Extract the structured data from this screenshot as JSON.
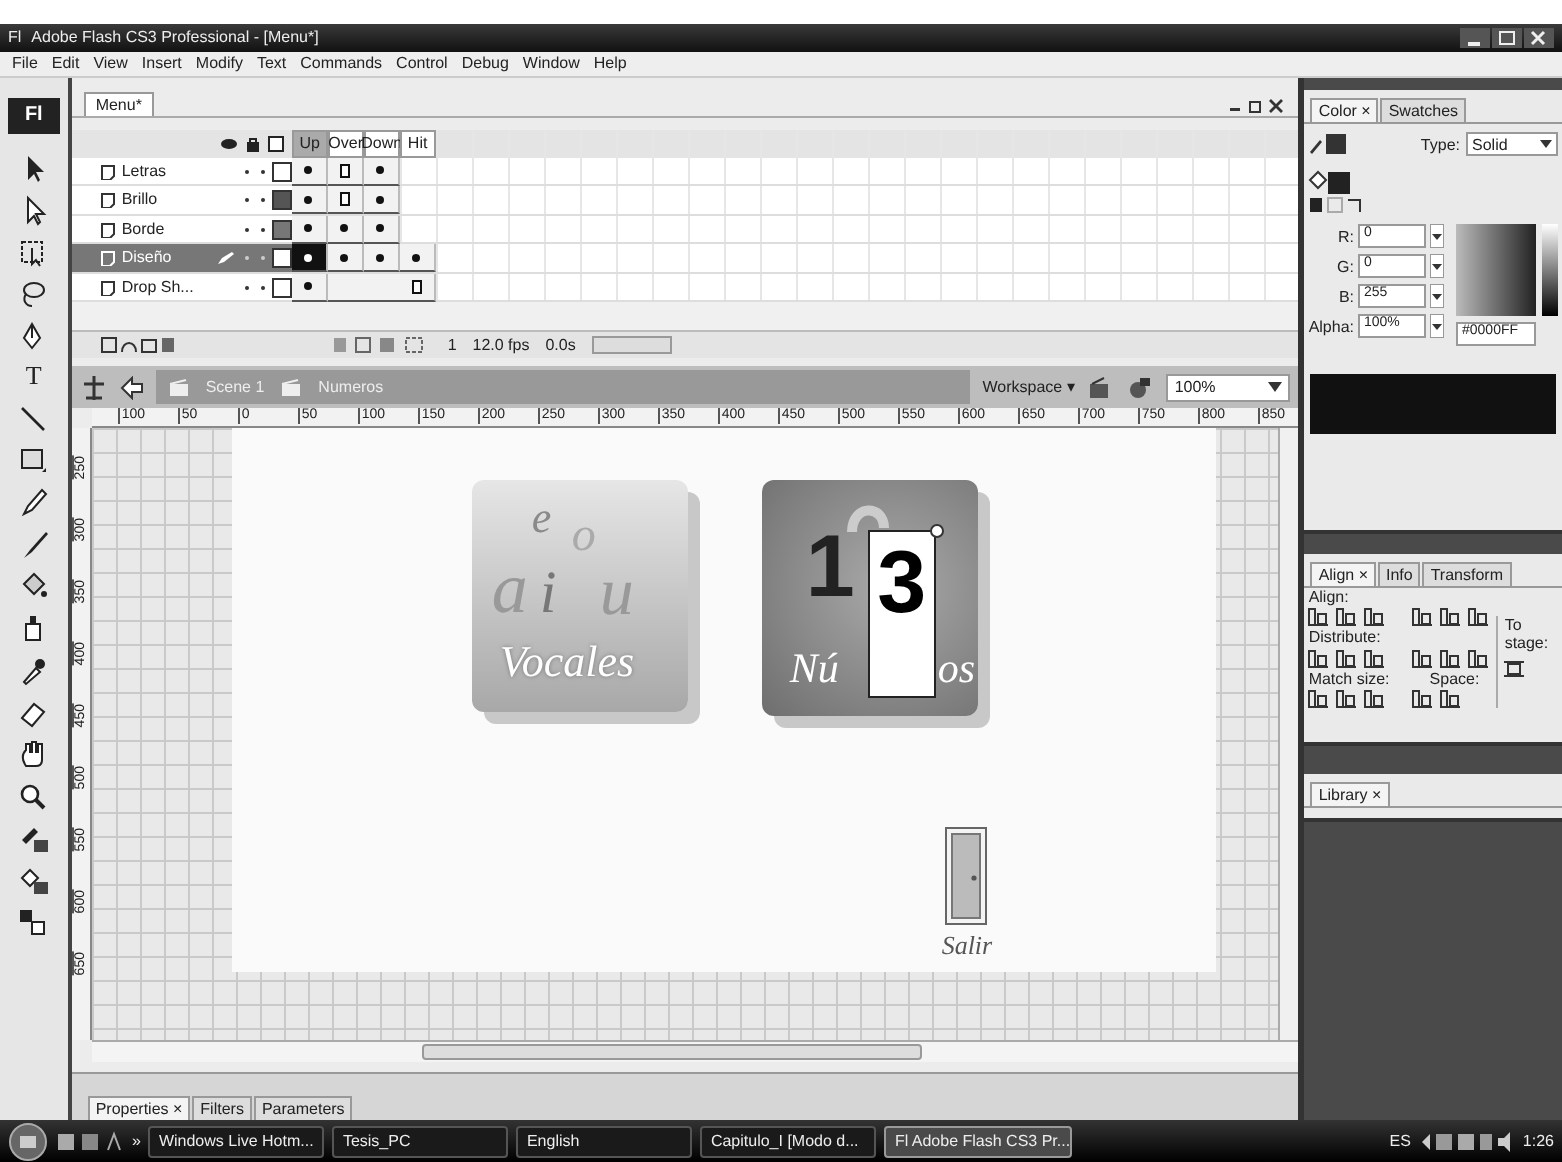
{
  "window": {
    "title": "Adobe Flash CS3 Professional - [Menu*]",
    "logo": "Fl"
  },
  "menu": [
    "File",
    "Edit",
    "View",
    "Insert",
    "Modify",
    "Text",
    "Commands",
    "Control",
    "Debug",
    "Window",
    "Help"
  ],
  "toolbox": {
    "logo": "Fl",
    "tools": [
      {
        "kind": "arrow"
      },
      {
        "kind": "subselect"
      },
      {
        "kind": "transform"
      },
      {
        "kind": "lasso"
      },
      {
        "kind": "pen"
      },
      {
        "kind": "text",
        "label": "T"
      },
      {
        "kind": "line"
      },
      {
        "kind": "rect"
      },
      {
        "kind": "pencil"
      },
      {
        "kind": "brush"
      },
      {
        "kind": "bucket"
      },
      {
        "kind": "inkbottle"
      },
      {
        "kind": "eyedropper"
      },
      {
        "kind": "eraser"
      },
      {
        "kind": "hand"
      },
      {
        "kind": "zoom"
      },
      {
        "kind": "stroke"
      },
      {
        "kind": "fill"
      },
      {
        "kind": "swap"
      }
    ]
  },
  "document": {
    "tab": "Menu*"
  },
  "timeline": {
    "frame_labels": [
      {
        "label": "Up",
        "selected": true
      },
      {
        "label": "Over",
        "selected": false
      },
      {
        "label": "Down",
        "selected": false
      },
      {
        "label": "Hit",
        "selected": false
      }
    ],
    "layers": [
      {
        "name": "Letras",
        "selected": false,
        "color": "#ffffff",
        "cells": [
          {
            "kind": "key"
          },
          {
            "kind": "end"
          },
          {
            "kind": "key"
          }
        ]
      },
      {
        "name": "Brillo",
        "selected": false,
        "color": "#555555",
        "cells": [
          {
            "kind": "key"
          },
          {
            "kind": "end"
          },
          {
            "kind": "key"
          }
        ]
      },
      {
        "name": "Borde",
        "selected": false,
        "color": "#777777",
        "cells": [
          {
            "kind": "key"
          },
          {
            "kind": "key"
          },
          {
            "kind": "key"
          }
        ]
      },
      {
        "name": "Diseño",
        "selected": true,
        "color": "#ffffff",
        "cells": [
          {
            "kind": "selected"
          },
          {
            "kind": "key"
          },
          {
            "kind": "key"
          },
          {
            "kind": "key"
          }
        ]
      },
      {
        "name": "Drop Sh...",
        "selected": false,
        "color": "#ffffff",
        "cells": [
          {
            "kind": "key"
          },
          {
            "kind": "span"
          },
          {
            "kind": "span"
          },
          {
            "kind": "end"
          }
        ]
      }
    ],
    "current_frame": "1",
    "fps": "12.0 fps",
    "time": "0.0s"
  },
  "edit_bar": {
    "crumbs": [
      "Scene 1",
      "Numeros"
    ],
    "workspace": "Workspace ▾",
    "zoom": "100%"
  },
  "rulers": {
    "x_labels": [
      "100",
      "50",
      "0",
      "50",
      "100",
      "150",
      "200",
      "250",
      "300",
      "350",
      "400",
      "450",
      "500",
      "550",
      "600",
      "650",
      "700",
      "750",
      "800",
      "850"
    ],
    "y_labels": [
      "250",
      "300",
      "350",
      "400",
      "450",
      "500",
      "550",
      "600",
      "650"
    ]
  },
  "stage": {
    "buttons": [
      {
        "kind": "vocales",
        "letters": [
          "a",
          "e",
          "i",
          "o",
          "u"
        ],
        "caption": "Vocales"
      },
      {
        "kind": "numeros",
        "digits": [
          "1",
          "3"
        ],
        "caption_parts": [
          "Nú",
          "os"
        ]
      },
      {
        "kind": "door",
        "caption": "Salir"
      }
    ]
  },
  "properties_panel": {
    "tabs": [
      {
        "label": "Properties ×",
        "selected": true
      },
      {
        "label": "Filters",
        "selected": false
      },
      {
        "label": "Parameters",
        "selected": false
      }
    ]
  },
  "color_panel": {
    "tabs": [
      {
        "label": "Color ×",
        "selected": true
      },
      {
        "label": "Swatches",
        "selected": false
      }
    ],
    "type_label": "Type:",
    "type": "Solid",
    "fields": [
      {
        "label": "R:",
        "value": "0"
      },
      {
        "label": "G:",
        "value": "0"
      },
      {
        "label": "B:",
        "value": "255"
      },
      {
        "label": "Alpha:",
        "value": "100%"
      }
    ],
    "hex": "#0000FF"
  },
  "align_panel": {
    "tabs": [
      {
        "label": "Align ×",
        "selected": true
      },
      {
        "label": "Info",
        "selected": false
      },
      {
        "label": "Transform",
        "selected": false
      }
    ],
    "sections": [
      "Align:",
      "Distribute:",
      "Match size:"
    ],
    "space_label": "Space:",
    "stage_label": "To stage:"
  },
  "library_panel": {
    "tabs": [
      {
        "label": "Library ×",
        "selected": true
      }
    ]
  },
  "taskbar": {
    "quick_launch": "»",
    "items": [
      {
        "label": "Windows Live Hotm...",
        "selected": false
      },
      {
        "label": "Tesis_PC",
        "selected": false
      },
      {
        "label": "English",
        "selected": false
      },
      {
        "label": "Capitulo_I [Modo d...",
        "selected": false
      },
      {
        "label": "Fl  Adobe Flash CS3 Pr...",
        "selected": true
      }
    ],
    "language": "ES",
    "clock": "1:26"
  }
}
